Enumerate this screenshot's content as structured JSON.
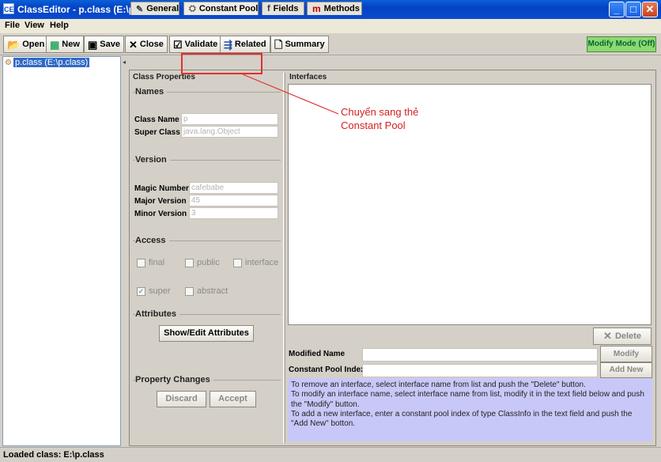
{
  "window": {
    "title": "ClassEditor - p.class (E:\\p.class)",
    "app_icon_text": "CE",
    "minimize_glyph": "_",
    "maximize_glyph": "□",
    "close_glyph": "✕"
  },
  "menu": [
    "File",
    "View",
    "Help"
  ],
  "toolbar": {
    "open": "Open",
    "new": "New",
    "save": "Save",
    "close": "Close",
    "validate": "Validate",
    "related": "Related",
    "summary": "Summary",
    "modify_mode": "Modify Mode (Off)",
    "icons": [
      "open-folder-icon",
      "new-file-icon",
      "floppy-disk-icon",
      "close-x-icon",
      "checkbox-icon",
      "related-icon",
      "document-icon"
    ]
  },
  "tree": {
    "selected_item": "p.class (E:\\p.class)"
  },
  "tabs": [
    {
      "label": "General",
      "active": false
    },
    {
      "label": "Constant Pool",
      "active": true
    },
    {
      "label": "Fields",
      "active": false
    },
    {
      "label": "Methods",
      "active": false
    }
  ],
  "class_properties": {
    "title": "Class Properties",
    "names": {
      "title": "Names",
      "class_name_label": "Class Name",
      "class_name_value": "p",
      "super_class_label": "Super Class",
      "super_class_value": "java.lang.Object"
    },
    "version": {
      "title": "Version",
      "magic_label": "Magic Number",
      "magic_value": "cafebabe",
      "major_label": "Major Version",
      "major_value": "45",
      "minor_label": "Minor Version",
      "minor_value": "3"
    },
    "access": {
      "title": "Access",
      "flags": [
        {
          "label": "final",
          "checked": false
        },
        {
          "label": "public",
          "checked": false
        },
        {
          "label": "interface",
          "checked": false
        },
        {
          "label": "super",
          "checked": true
        },
        {
          "label": "abstract",
          "checked": false
        }
      ]
    },
    "attributes": {
      "title": "Attributes",
      "button": "Show/Edit Attributes"
    },
    "property_changes": {
      "title": "Property Changes",
      "discard": "Discard",
      "accept": "Accept"
    }
  },
  "interfaces": {
    "title": "Interfaces",
    "delete_button": "Delete",
    "modified_name_label": "Modified Name",
    "modify_button": "Modify",
    "cp_index_label": "Constant Pool Index",
    "add_new_button": "Add New",
    "help": [
      "To remove an interface, select interface name from list and push the \"Delete\" button.",
      "To modify an interface name, select interface name from list, modify it in the text field below and push the \"Modify\" button.",
      "To add a new interface, enter a constant pool index of type ClassInfo in the text field and push the \"Add New\" botton."
    ]
  },
  "annotation": {
    "line1": "Chuyển sang thẻ",
    "line2": "Constant Pool",
    "color": "#d62020"
  },
  "status": "Loaded class: E:\\p.class"
}
